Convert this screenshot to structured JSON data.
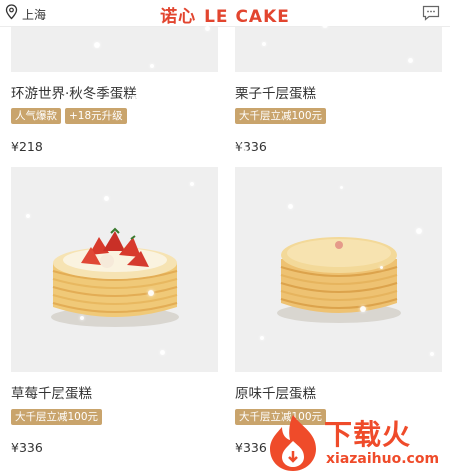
{
  "header": {
    "location": "上海",
    "brand_cn": "诺心",
    "brand_en": "LE CAKE"
  },
  "products": [
    {
      "title": "环游世界·秋冬季蛋糕",
      "tags": [
        "人气爆款",
        "+18元升级"
      ],
      "price": "¥218"
    },
    {
      "title": "栗子千层蛋糕",
      "tags": [
        "大千层立减100元"
      ],
      "price": "¥336"
    },
    {
      "title": "草莓千层蛋糕",
      "tags": [
        "大千层立减100元"
      ],
      "price": "¥336"
    },
    {
      "title": "原味千层蛋糕",
      "tags": [
        "大千层立减100元"
      ],
      "price": "¥336"
    }
  ],
  "watermark": {
    "name": "下载火",
    "url": "xiazaihuo.com"
  },
  "colors": {
    "brand": "#e2452f",
    "tag_bg": "#c9a46c",
    "image_bg": "#efefef"
  }
}
